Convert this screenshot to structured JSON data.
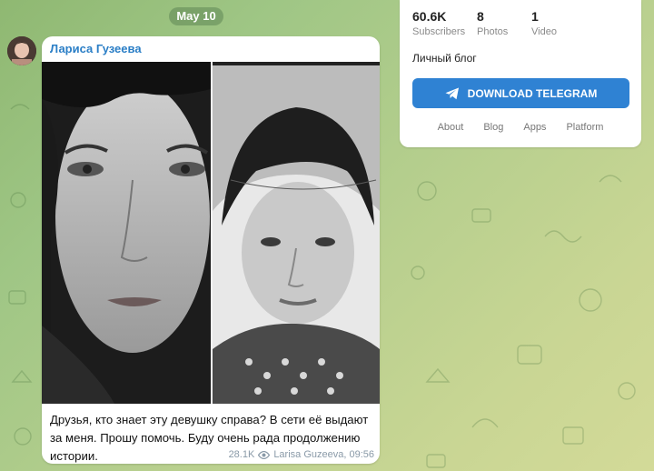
{
  "date_pill": "May 10",
  "message": {
    "author": "Лариса Гузеева",
    "text": "Друзья, кто знает эту девушку справа? В сети её выдают за меня. Прошу помочь. Буду очень рада продолжению истории.",
    "views": "28.1K",
    "signature": "Larisa Guzeeva, 09:56"
  },
  "channel": {
    "stats": [
      {
        "value": "60.6K",
        "label": "Subscribers"
      },
      {
        "value": "8",
        "label": "Photos"
      },
      {
        "value": "1",
        "label": "Video"
      }
    ],
    "description": "Личный блог",
    "download_label": "DOWNLOAD TELEGRAM",
    "links": [
      "About",
      "Blog",
      "Apps",
      "Platform"
    ]
  },
  "colors": {
    "accent": "#2f82d3",
    "author": "#2a7ec6"
  },
  "icons": [
    "telegram-icon",
    "eye-icon"
  ]
}
